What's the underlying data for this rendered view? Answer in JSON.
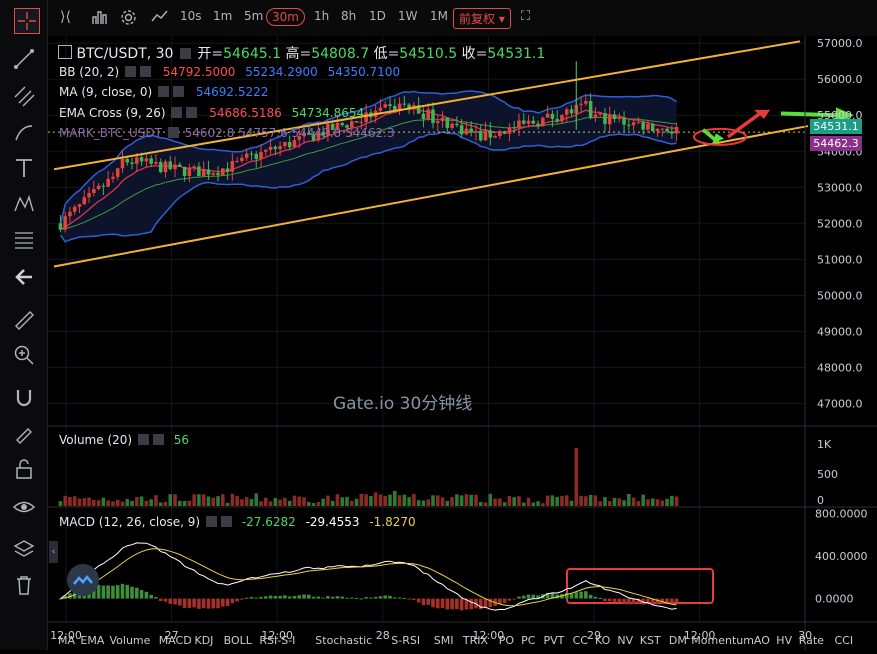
{
  "toolbar": {
    "interval_items": [
      "10s",
      "1m",
      "5m",
      "30m",
      "1h",
      "8h",
      "1D",
      "1W",
      "1M"
    ],
    "active_interval": "30m",
    "adjust_label": "前复权"
  },
  "legend": {
    "symbol": "BTC/USDT, 30",
    "open_label": "开",
    "open": "54645.1",
    "high_label": "高",
    "high": "54808.7",
    "low_label": "低",
    "low": "54510.5",
    "close_label": "收",
    "close": "54531.1",
    "bb": {
      "label": "BB (20, 2)",
      "v1": "54792.5000",
      "v2": "55234.2900",
      "v3": "54350.7100"
    },
    "ma": {
      "label": "MA (9, close, 0)",
      "v1": "54692.5222"
    },
    "ema": {
      "label": "EMA Cross (9, 26)",
      "v1": "54686.5186",
      "v2": "54734.8654"
    },
    "mark": {
      "label": "MARK_BTC_USDT",
      "v1": "54602.8",
      "v2": "54757.6",
      "v3": "54449.8",
      "v4": "54462.3"
    }
  },
  "watermark": "Gate.io 30分钟线",
  "price_tag_close": "54531.1",
  "price_tag_mark": "54462.3",
  "volume": {
    "label": "Volume (20)",
    "value": "56",
    "axis": [
      "1K",
      "500",
      "0"
    ]
  },
  "macd": {
    "label": "MACD (12, 26, close, 9)",
    "v1": "-27.6282",
    "v2": "-29.4553",
    "v3": "-1.8270",
    "axis": [
      "800.0000",
      "400.0000",
      "0.0000"
    ]
  },
  "time_axis": [
    {
      "t": 0,
      "label": "12:00"
    },
    {
      "t": 0.22,
      "label": "27"
    },
    {
      "t": 0.44,
      "label": "12:00"
    },
    {
      "t": 0.66,
      "label": "28"
    },
    {
      "t": 0.88,
      "label": "12:00"
    },
    {
      "t": 1.1,
      "label": "29"
    },
    {
      "t": 1.32,
      "label": "12:00"
    },
    {
      "t": 1.54,
      "label": "30"
    }
  ],
  "indicator_tabs": [
    "MA",
    "EMA",
    "Volume",
    "MACD",
    "KDJ",
    "BOLL",
    "RSI-S-I",
    "Stochastic",
    "S-RSI",
    "SMI",
    "TRIX",
    "PO",
    "PC",
    "PVT",
    "CC",
    "KO",
    "NV",
    "KST",
    "DM",
    "Momentum",
    "AO",
    "HV",
    "Rate",
    "CCI"
  ],
  "colors": {
    "up": "#e0443a",
    "down": "#4caf50",
    "bb": "#2f5fd8",
    "channel": "#f2b234",
    "ema_fast": "#d9344a",
    "ema_slow": "#3f9a3f",
    "macd_line": "#ffffff",
    "signal_line": "#e8d24a",
    "arrow_green": "#58e03a",
    "arrow_red": "#e83a3a"
  },
  "chart_data": {
    "type": "candlestick",
    "price_axis": [
      57000,
      56000,
      55000,
      54000,
      53000,
      52000,
      51000,
      50000,
      49000,
      48000,
      47000
    ],
    "ylim": [
      46400,
      57200
    ],
    "volume_max": 1000,
    "macd_ylim": [
      -220,
      860
    ],
    "series_open": 52000,
    "series_end": 54531,
    "candles": 130
  }
}
